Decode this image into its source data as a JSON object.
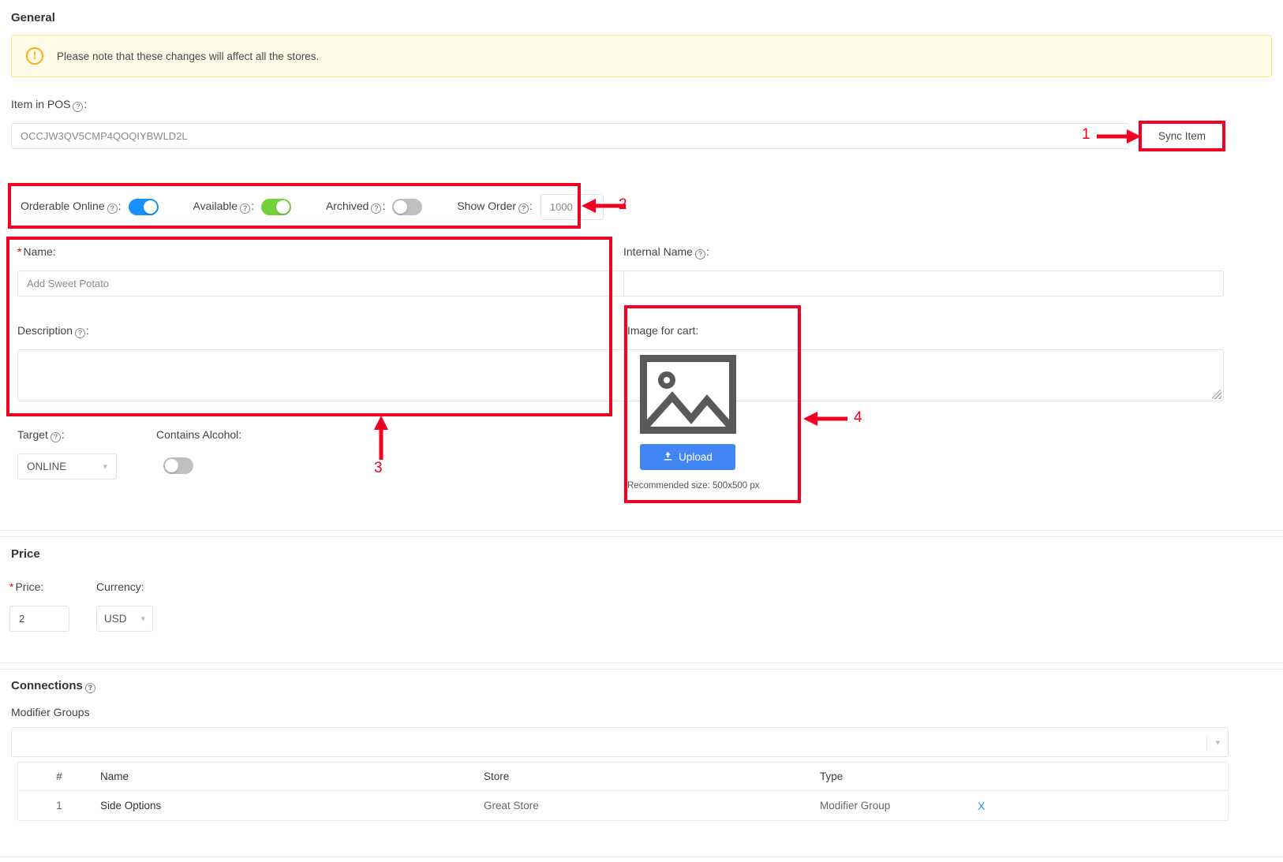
{
  "general": {
    "title": "General",
    "warning": "Please note that these changes will affect all the stores.",
    "warning_icon": "exclamation-circle-icon"
  },
  "pos": {
    "label": "Item in POS",
    "value": "OCCJW3QV5CMP4QOQIYBWLD2L",
    "sync_button": "Sync Item"
  },
  "toggles": {
    "orderable_online": {
      "label": "Orderable Online",
      "state": "on",
      "color": "#1890ff"
    },
    "available": {
      "label": "Available",
      "state": "on",
      "color": "#73d13d"
    },
    "archived": {
      "label": "Archived",
      "state": "off",
      "color": "#bfbfbf"
    },
    "show_order": {
      "label": "Show Order",
      "value": "1000"
    }
  },
  "name_section": {
    "name_label": "Name",
    "name_value": "Add Sweet Potato",
    "description_label": "Description"
  },
  "internal": {
    "label": "Internal Name",
    "value": ""
  },
  "image_for_cart": {
    "label": "Image for cart",
    "placeholder_icon": "image-placeholder-icon",
    "upload_button": "Upload",
    "upload_icon": "upload-icon",
    "recommended": "Recommended size: 500x500 px"
  },
  "target": {
    "label": "Target",
    "value": "ONLINE"
  },
  "alcohol": {
    "label": "Contains Alcohol",
    "state": "off"
  },
  "price": {
    "title": "Price",
    "price_label": "Price",
    "price_value": "2",
    "currency_label": "Currency",
    "currency_value": "USD"
  },
  "connections": {
    "title": "Connections",
    "modifier_groups_label": "Modifier Groups",
    "select_value": "",
    "table": {
      "headers": [
        "#",
        "Name",
        "Store",
        "Type",
        ""
      ],
      "rows": [
        {
          "index": "1",
          "name": "Side Options",
          "store": "Great Store",
          "type": "Modifier Group",
          "action": "X"
        }
      ]
    }
  },
  "annotations": {
    "a1": "1",
    "a2": "2",
    "a3": "3",
    "a4": "4",
    "color": "#f20021"
  }
}
